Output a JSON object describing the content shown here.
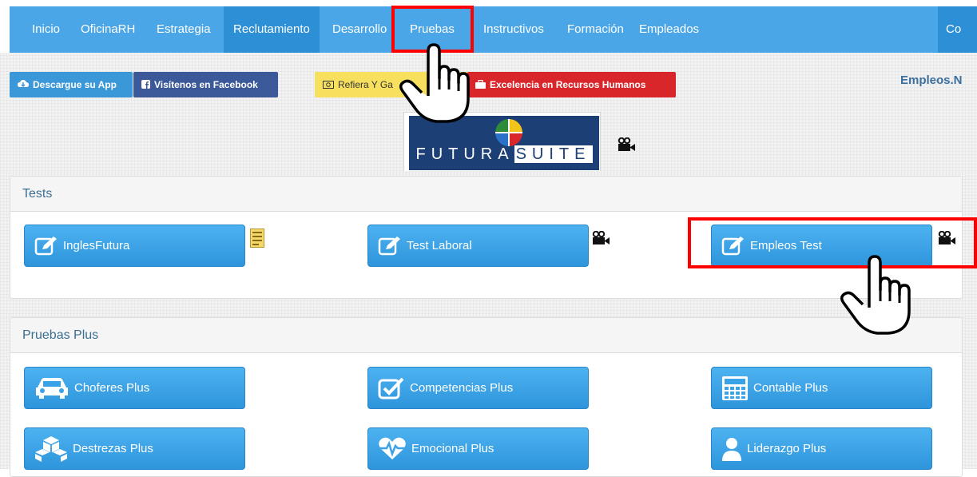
{
  "navbar": {
    "items": [
      {
        "label": "Inicio"
      },
      {
        "label": "OficinaRH"
      },
      {
        "label": "Estrategia"
      },
      {
        "label": "Reclutamiento"
      },
      {
        "label": "Desarrollo"
      },
      {
        "label": "Pruebas"
      },
      {
        "label": "Instructivos"
      },
      {
        "label": "Formación"
      },
      {
        "label": "Empleados"
      },
      {
        "label": "Co"
      }
    ]
  },
  "topbar": {
    "app_label": "Descargue su App",
    "facebook_label": "Visítenos en Facebook",
    "refiera_label": "Refiera Y Ga",
    "excelencia_label": "Excelencia en Recursos Humanos",
    "empleos_link": "Empleos.N"
  },
  "logo": {
    "text_a": "FUTURA",
    "text_b": "SUITE"
  },
  "tests": {
    "title": "Tests",
    "buttons": [
      {
        "label": "InglesFutura",
        "icon": "edit-icon"
      },
      {
        "label": "Test Laboral",
        "icon": "edit-icon"
      },
      {
        "label": "Empleos Test",
        "icon": "edit-icon"
      }
    ]
  },
  "plus": {
    "title": "Pruebas Plus",
    "buttons": [
      {
        "label": "Choferes Plus",
        "icon": "car-icon"
      },
      {
        "label": "Competencias Plus",
        "icon": "checkbox-icon"
      },
      {
        "label": "Contable Plus",
        "icon": "calculator-icon"
      },
      {
        "label": "Destrezas Plus",
        "icon": "cubes-icon"
      },
      {
        "label": "Emocional Plus",
        "icon": "heartbeat-icon"
      },
      {
        "label": "Liderazgo Plus",
        "icon": "user-icon"
      }
    ]
  },
  "colors": {
    "nav": "#4aa6e6",
    "button": "#3aa2e6",
    "highlight": "#ff0000",
    "facebook": "#3b5998",
    "excelencia": "#d9262a",
    "refiera": "#f6e05e"
  }
}
